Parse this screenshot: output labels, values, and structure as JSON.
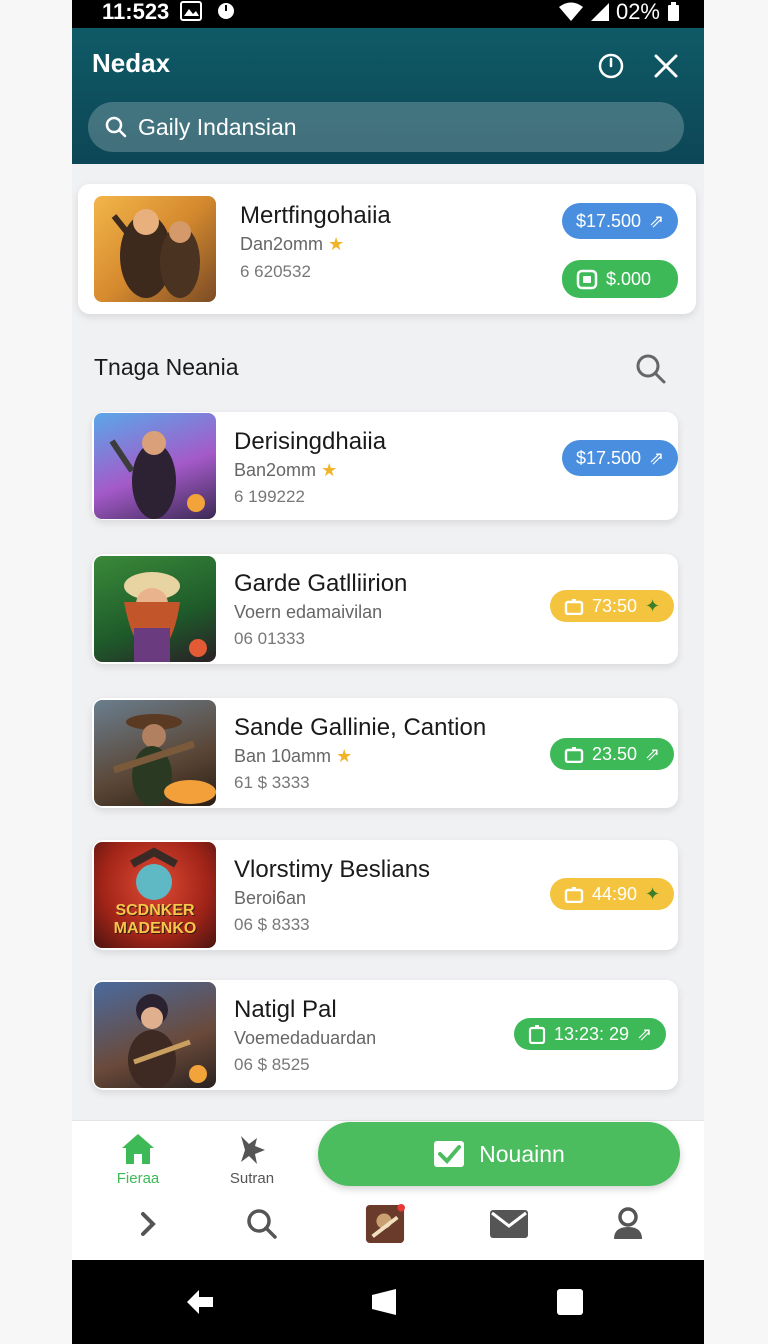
{
  "status_bar": {
    "time": "11:523",
    "battery": "02%"
  },
  "header": {
    "title": "Nedax"
  },
  "search": {
    "value": "Gaily Indansian"
  },
  "featured": {
    "title": "Mertfingohaiia",
    "subtitle": "Dan2omm",
    "meta": "6 620532",
    "price": "$17.500",
    "buy_label": "$.000"
  },
  "section": {
    "title": "Tnaga Neania"
  },
  "items": [
    {
      "title": "Derisingdhaiia",
      "subtitle": "Ban2omm",
      "meta": "6 199222",
      "action": "$17.500",
      "color": "blue"
    },
    {
      "title": "Garde Gatlliirion",
      "subtitle": "Voern edamaivilan",
      "meta": "06 01333",
      "action": "73:50",
      "color": "yellow"
    },
    {
      "title": "Sande Gallinie, Cantion",
      "subtitle": "Ban 10amm",
      "meta": "61 $ 3333",
      "action": "23.50",
      "color": "green"
    },
    {
      "title": "Vlorstimy Beslians",
      "subtitle": "Beroi6an",
      "meta": "06 $ 8333",
      "action": "44:90",
      "color": "yellow"
    },
    {
      "title": "Natigl Pal",
      "subtitle": "Voemedaduardan",
      "meta": "06 $ 8525",
      "action": "13:23: 29",
      "color": "green"
    }
  ],
  "thumb4_text": "SCDNKER MADENKO",
  "bottom_nav": {
    "tab_home": "Fieraa",
    "tab_second": "Sutran",
    "primary_button": "Nouainn"
  },
  "colors": {
    "header": "#0d4656",
    "accent_green": "#3dba57",
    "accent_blue": "#4a8fdf",
    "accent_yellow": "#f4c43e"
  }
}
